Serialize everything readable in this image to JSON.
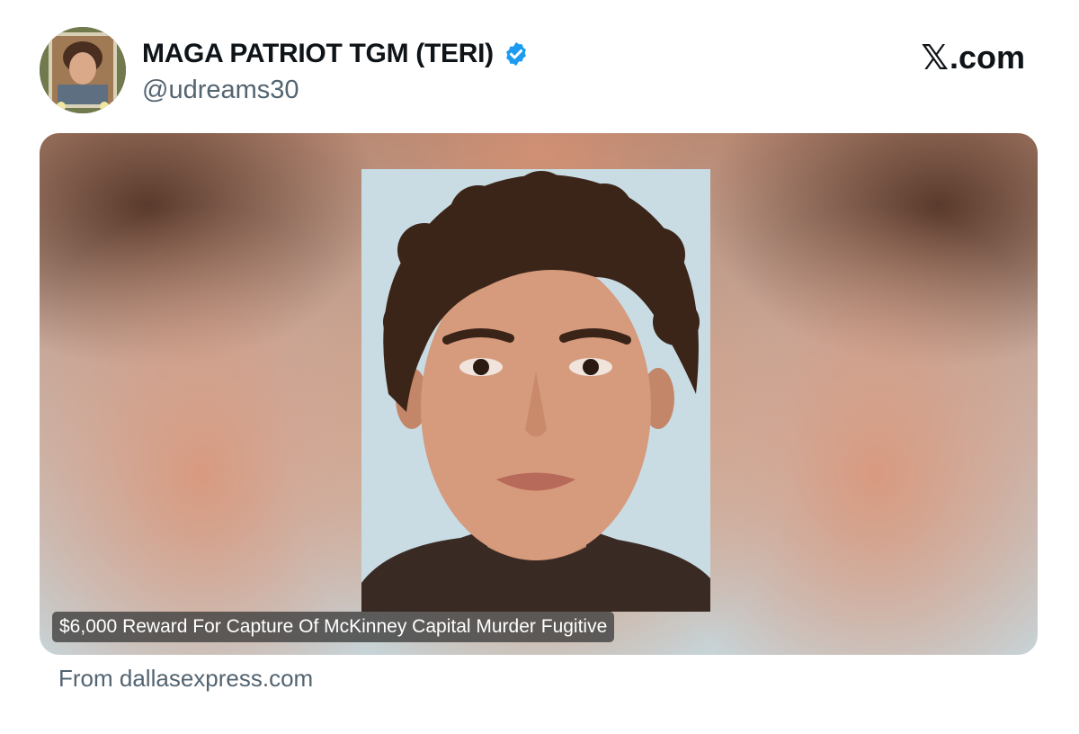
{
  "header": {
    "display_name": "MAGA PATRIOT TGM (TERI)",
    "handle": "@udreams30",
    "verified_icon": "verified-badge-icon",
    "brand_x": "𝕏",
    "brand_suffix": ".com"
  },
  "card": {
    "caption": "$6,000 Reward For Capture Of McKinney Capital Murder Fugitive",
    "source": "From dallasexpress.com"
  },
  "colors": {
    "verified": "#1d9bf0",
    "handle": "#536471",
    "caption_bg": "#3c3c3c"
  }
}
